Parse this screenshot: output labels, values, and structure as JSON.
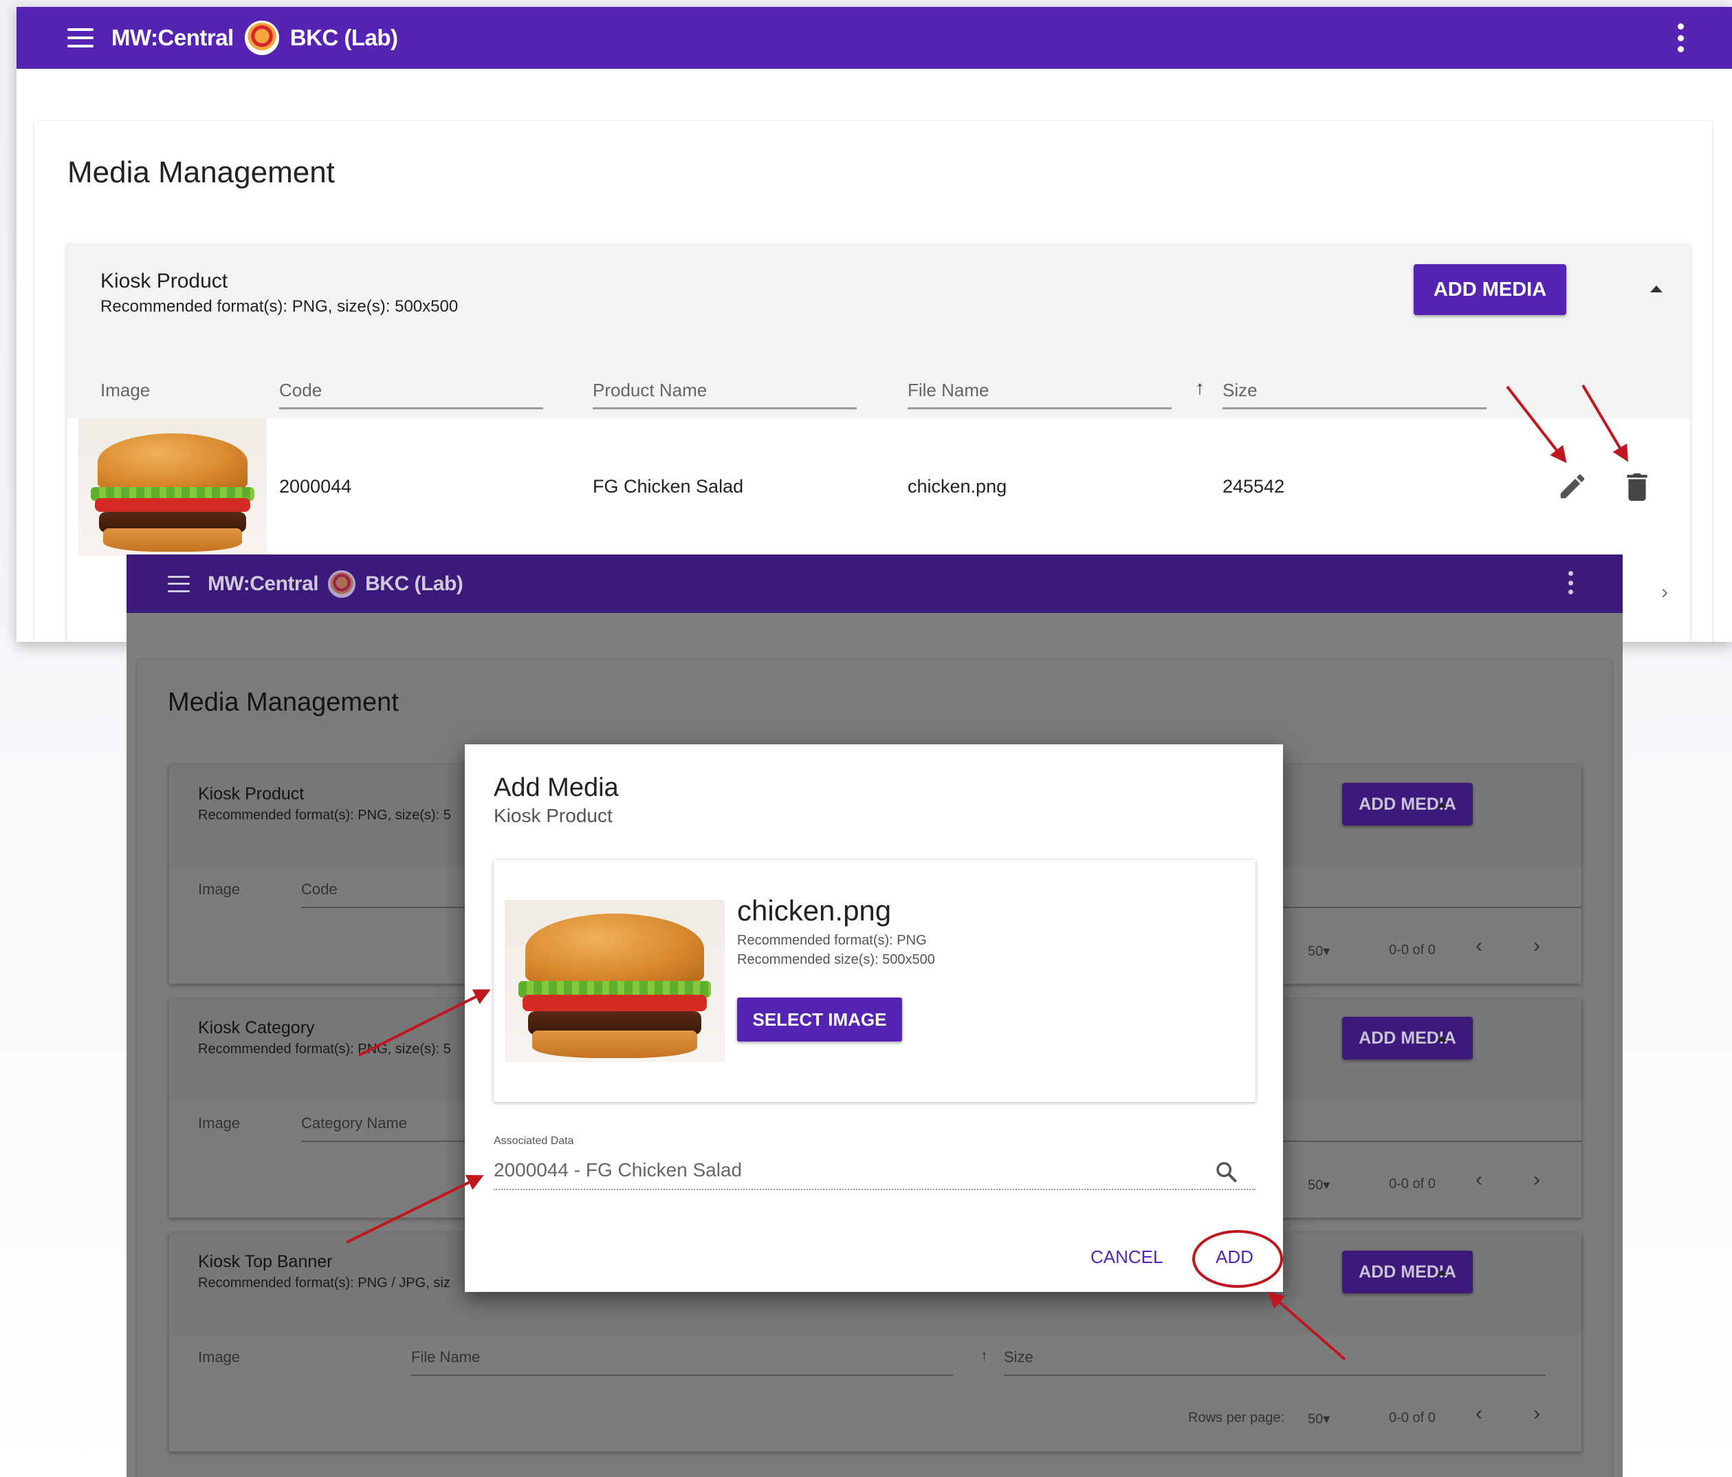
{
  "back_window": {
    "topbar": {
      "app_name": "MW:Central",
      "org_name": "BKC (Lab)"
    },
    "page_title": "Media Management",
    "card": {
      "title": "Kiosk Product",
      "subtitle": "Recommended format(s): PNG, size(s): 500x500",
      "add_button": "ADD MEDIA",
      "columns": [
        "Image",
        "Code",
        "Product Name",
        "File Name",
        "Size"
      ],
      "row": {
        "code": "2000044",
        "product_name": "FG Chicken Salad",
        "file_name": "chicken.png",
        "size": "245542"
      }
    }
  },
  "front_window": {
    "topbar": {
      "app_name": "MW:Central",
      "org_name": "BKC (Lab)"
    },
    "page_title": "Media Management",
    "cards": [
      {
        "title": "Kiosk Product",
        "subtitle": "Recommended format(s): PNG, size(s): 5",
        "add_button": "ADD MEDIA",
        "col1": "Image",
        "col2": "Code",
        "rows_value": "50",
        "range": "0-0 of 0"
      },
      {
        "title": "Kiosk Category",
        "subtitle": "Recommended format(s): PNG, size(s): 5",
        "add_button": "ADD MEDIA",
        "col1": "Image",
        "col2": "Category Name",
        "rows_value": "50",
        "range": "0-0 of 0"
      },
      {
        "title": "Kiosk Top Banner",
        "subtitle": "Recommended format(s): PNG / JPG, siz",
        "add_button": "ADD MEDIA",
        "col1": "Image",
        "col2": "File Name",
        "col3": "Size",
        "rows_label": "Rows per page:",
        "rows_value": "50",
        "range": "0-0 of 0"
      }
    ]
  },
  "dialog": {
    "title": "Add Media",
    "subtitle": "Kiosk Product",
    "file_name": "chicken.png",
    "rec_format": "Recommended format(s): PNG",
    "rec_size": "Recommended size(s): 500x500",
    "select_button": "SELECT IMAGE",
    "assoc_label": "Associated Data",
    "assoc_value": "2000044 - FG Chicken Salad",
    "cancel_button": "CANCEL",
    "add_button": "ADD"
  },
  "colors": {
    "brand": "#5624b3",
    "annotation": "#c0161e"
  },
  "icons": [
    "menu-icon",
    "brand-logo",
    "more-vert-icon",
    "sort-up-icon",
    "edit-icon",
    "delete-icon",
    "expand-less-icon",
    "chevron-left-icon",
    "chevron-right-icon",
    "search-icon"
  ]
}
